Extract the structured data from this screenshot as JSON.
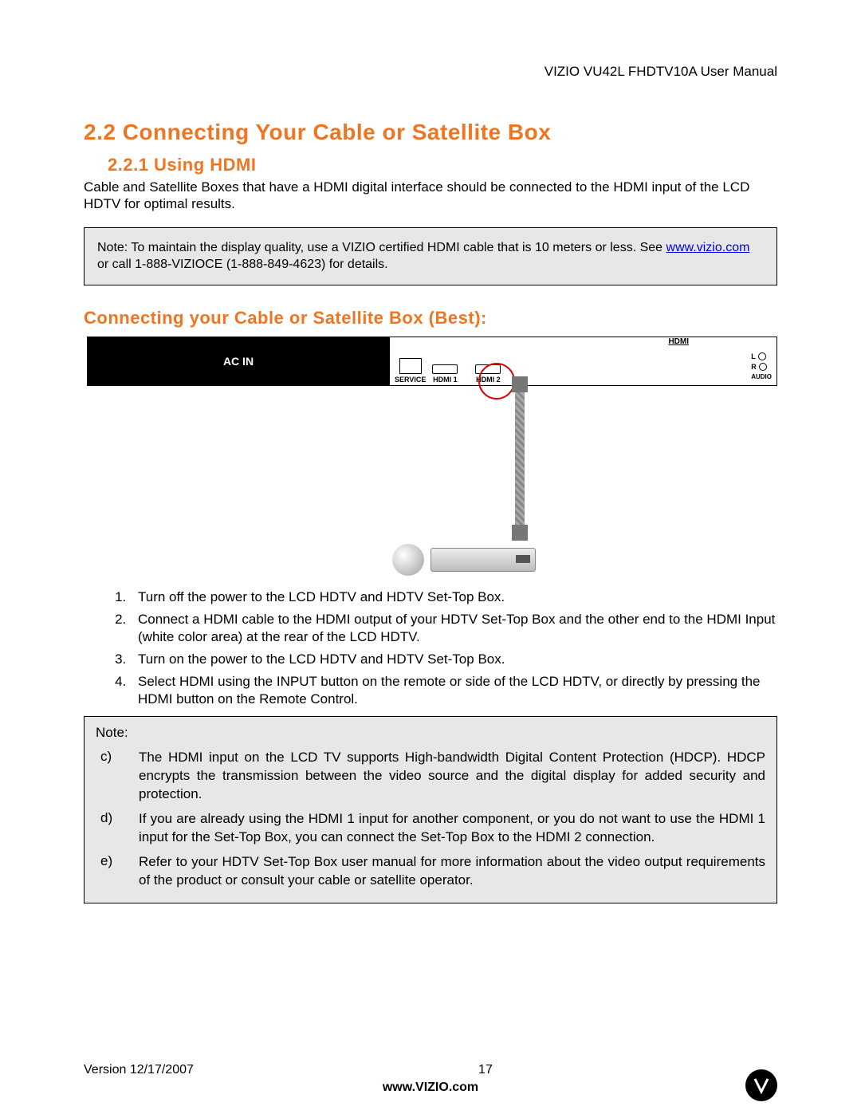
{
  "header": {
    "title": "VIZIO VU42L FHDTV10A User Manual"
  },
  "section": {
    "num_title": "2.2  Connecting Your Cable or Satellite Box",
    "sub_num_title": "2.2.1 Using HDMI",
    "intro": "Cable and Satellite Boxes that have a HDMI digital interface should be connected to the HDMI input of the LCD HDTV for optimal results.",
    "note1_pre": "Note: To maintain the display quality, use a VIZIO certified HDMI cable that is 10 meters or less.  See ",
    "note1_link": "www.vizio.com",
    "note1_post": " or call 1-888-VIZIOCE (1-888-849-4623) for details.",
    "subhead": "Connecting your Cable or Satellite Box (Best):"
  },
  "diagram": {
    "ac_in": "AC  IN",
    "service": "SERVICE",
    "hdmi_title": "HDMI",
    "hdmi1": "HDMI 1",
    "hdmi2": "HDMI 2",
    "audio_l": "L",
    "audio_r": "R",
    "audio": "AUDIO"
  },
  "steps": [
    "Turn off the power to the LCD HDTV and HDTV Set-Top Box.",
    "Connect a HDMI cable to the HDMI output of your HDTV Set-Top Box and the other end to the HDMI Input (white color area) at the rear of the LCD HDTV.",
    "Turn on the power to the LCD HDTV and HDTV Set-Top Box.",
    "Select HDMI using the INPUT button on the remote or side of the LCD HDTV, or directly by pressing the HDMI button on the Remote Control."
  ],
  "note2": {
    "label": "Note:",
    "items": [
      {
        "k": "c)",
        "v": "The HDMI input on the LCD TV supports High-bandwidth Digital Content Protection (HDCP).  HDCP encrypts the transmission between the video source and the digital display for added security and protection."
      },
      {
        "k": "d)",
        "v": "If you are already using the HDMI 1 input for another component, or you do not want to use the HDMI 1 input for the Set-Top Box, you can connect the Set-Top Box to the HDMI 2 connection."
      },
      {
        "k": "e)",
        "v": "Refer to your HDTV Set-Top Box user manual for more information about the video output requirements of the product or consult your cable or satellite operator."
      }
    ]
  },
  "footer": {
    "version": "Version 12/17/2007",
    "page": "17",
    "url": "www.VIZIO.com"
  }
}
